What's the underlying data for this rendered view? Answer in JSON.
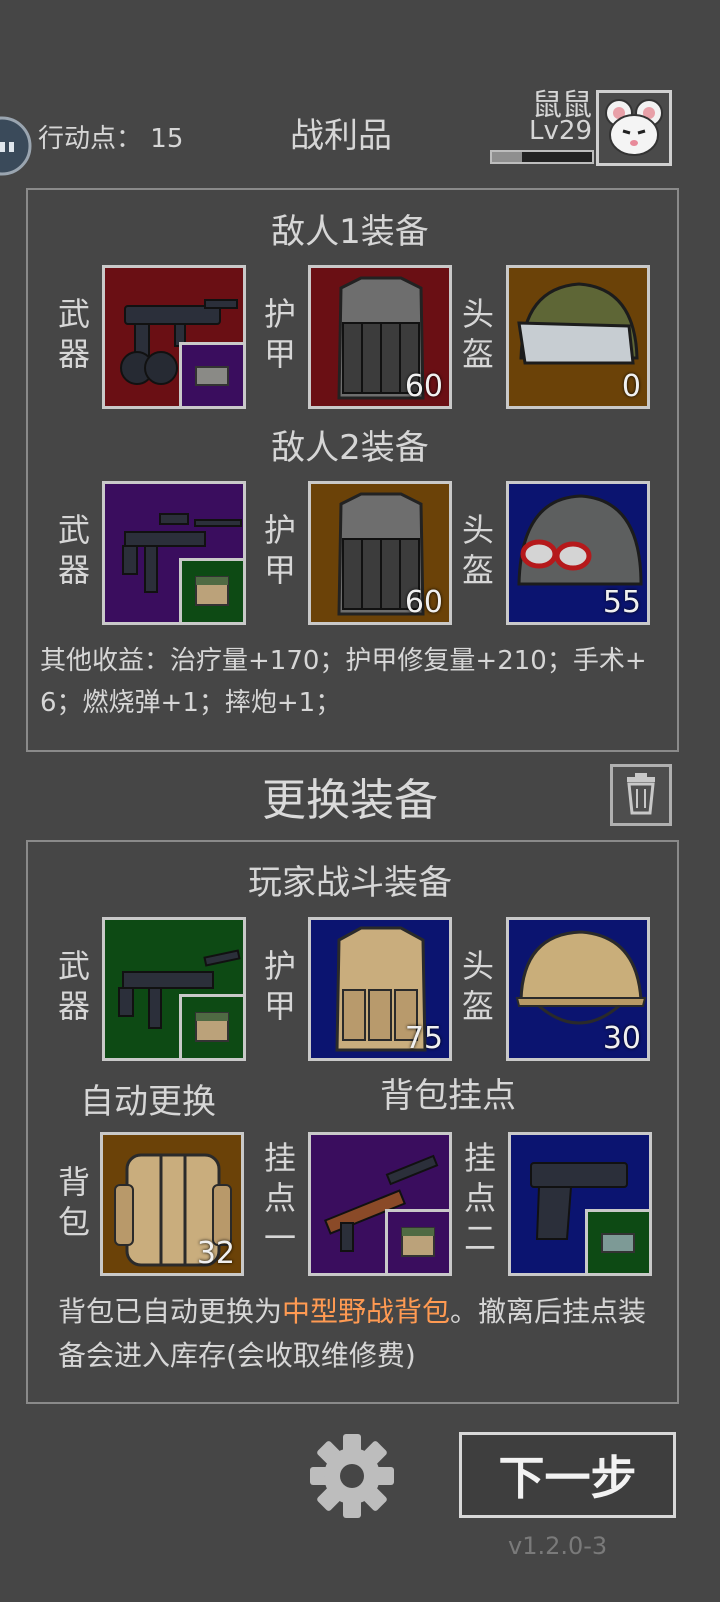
{
  "header": {
    "action_points_label": "行动点：",
    "action_points_value": "15",
    "title": "战利品",
    "player_name": "鼠鼠",
    "player_level": "Lv29",
    "xp_progress": 0.3
  },
  "loot": {
    "enemy1_title": "敌人1装备",
    "enemy2_title": "敌人2装备",
    "labels": {
      "weapon": [
        "武",
        "器"
      ],
      "armor": [
        "护",
        "甲"
      ],
      "helmet": [
        "头",
        "盔"
      ]
    },
    "enemy1": {
      "armor_value": "60",
      "helmet_value": "0"
    },
    "enemy2": {
      "armor_value": "60",
      "helmet_value": "55"
    },
    "other_gains": "其他收益：治疗量+170；护甲修复量+210；手术+6；燃烧弹+1；摔炮+1；"
  },
  "swap": {
    "title": "更换装备",
    "player_title": "玩家战斗装备",
    "armor_value": "75",
    "helmet_value": "30",
    "auto_swap_label": "自动更换",
    "backpack_mounts_label": "背包挂点",
    "backpack_label": [
      "背",
      "包"
    ],
    "mount1_label": [
      "挂",
      "点",
      "一"
    ],
    "mount2_label": [
      "挂",
      "点",
      "二"
    ],
    "backpack_value": "32",
    "note_prefix": "背包已自动更换为",
    "note_highlight": "中型野战背包",
    "note_suffix": "。撤离后挂点装备会进入库存(会收取维修费)"
  },
  "footer": {
    "next_button": "下一步",
    "version": "v1.2.0-3"
  },
  "colors": {
    "highlight": "#ff9a52",
    "background": "#464646"
  }
}
